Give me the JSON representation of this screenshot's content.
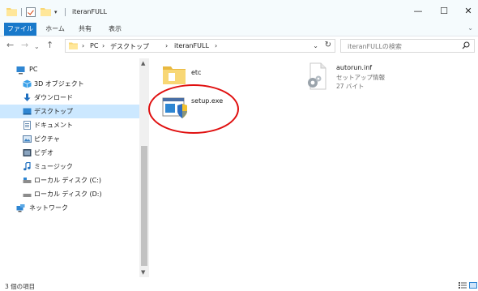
{
  "window": {
    "title": "iteranFULL",
    "controls": {
      "minimize": "—",
      "maximize": "☐",
      "close": "✕"
    }
  },
  "ribbon": {
    "tabs": [
      "ファイル",
      "ホーム",
      "共有",
      "表示"
    ],
    "expand": "⌄"
  },
  "nav": {
    "back": "←",
    "forward": "→",
    "recent": "⌄",
    "up": "↑"
  },
  "address": {
    "crumbs": [
      "PC",
      "デスクトップ",
      "iteranFULL"
    ],
    "separator": "›",
    "dropdown": "⌄",
    "refresh": "↻"
  },
  "search": {
    "placeholder": "iteranFULLの検索"
  },
  "sidebar": {
    "items": [
      {
        "label": "PC",
        "icon": "pc-icon"
      },
      {
        "label": "3D オブジェクト",
        "icon": "3d-objects-icon"
      },
      {
        "label": "ダウンロード",
        "icon": "download-icon"
      },
      {
        "label": "デスクトップ",
        "icon": "desktop-icon",
        "selected": true
      },
      {
        "label": "ドキュメント",
        "icon": "documents-icon"
      },
      {
        "label": "ピクチャ",
        "icon": "pictures-icon"
      },
      {
        "label": "ビデオ",
        "icon": "videos-icon"
      },
      {
        "label": "ミュージック",
        "icon": "music-icon"
      },
      {
        "label": "ローカル ディスク (C:)",
        "icon": "drive-icon"
      },
      {
        "label": "ローカル ディスク (D:)",
        "icon": "drive-icon"
      },
      {
        "label": "ネットワーク",
        "icon": "network-icon"
      }
    ]
  },
  "files": [
    {
      "name": "etc",
      "type": "folder",
      "icon": "folder-icon"
    },
    {
      "name": "autorun.inf",
      "type_label": "セットアップ情報",
      "size": "27 バイト",
      "icon": "settings-file-icon"
    },
    {
      "name": "setup.exe",
      "type": "application",
      "icon": "installer-shield-icon",
      "highlighted": true
    }
  ],
  "status": {
    "item_count": "3 個の項目"
  },
  "colors": {
    "accent": "#1979ca",
    "selected": "#cce8ff",
    "highlight_ring": "#e01010"
  }
}
